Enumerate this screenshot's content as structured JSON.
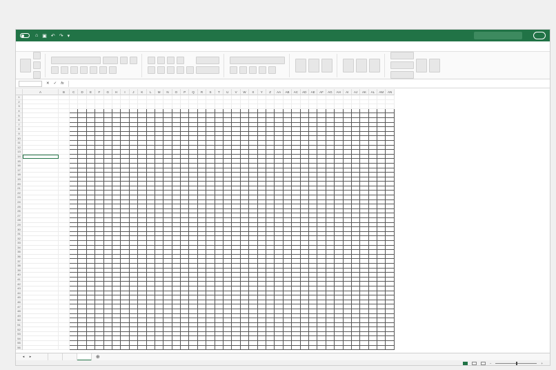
{
  "window": {
    "doc_title": "",
    "search_placeholder": ""
  },
  "ribbon_tabs": [
    "",
    "",
    "",
    "",
    "",
    "",
    "",
    "",
    ""
  ],
  "ribbon_tabs_right": [
    "",
    ""
  ],
  "formula_bar": {
    "name_box": "",
    "fx_label": "fx",
    "formula": ""
  },
  "column_headers_lead": [
    "A",
    "B"
  ],
  "column_headers_visible": [
    "C",
    "D",
    "E",
    "F",
    "G",
    "H",
    "I",
    "J",
    "K",
    "L",
    "M",
    "N",
    "O",
    "P",
    "Q",
    "R",
    "S",
    "T",
    "U",
    "V",
    "W",
    "X",
    "Y",
    "Z",
    "AA",
    "AB",
    "AC",
    "AD",
    "AE",
    "AF",
    "AG",
    "AH",
    "AI",
    "AJ",
    "AK",
    "AL",
    "AM",
    "AN"
  ],
  "row_headers_visible_count": 56,
  "cell_A1": "",
  "cell_A2": "",
  "row3_header_values": [],
  "colB_values": [],
  "grid_cells": [],
  "sheet_tabs": [
    {
      "label": "",
      "active": false
    },
    {
      "label": "",
      "active": false
    },
    {
      "label": "",
      "active": false
    },
    {
      "label": "",
      "active": true
    }
  ],
  "status": {
    "zoom": ""
  },
  "colors": {
    "accent": "#217346"
  }
}
